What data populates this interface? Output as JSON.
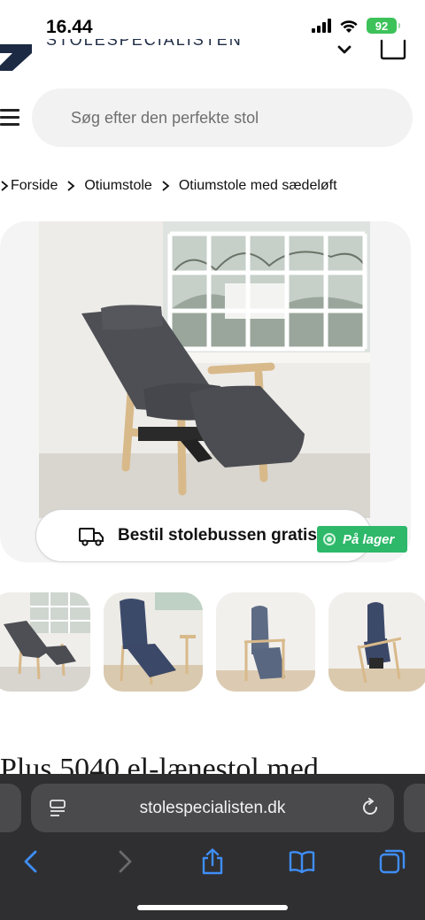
{
  "status_bar": {
    "time": "16.44",
    "battery": "92"
  },
  "header": {
    "logo_text": "STOLESPECIALISTEN",
    "logo_icon": "brand-logo-icon",
    "account_chevron_icon": "chevron-down-icon",
    "cart_icon": "bag-icon"
  },
  "search": {
    "placeholder": "Søg efter den perfekte stol",
    "menu_icon": "hamburger-menu-icon"
  },
  "breadcrumb": {
    "items": [
      "Forside",
      "Otiumstole",
      "Otiumstole med sædeløft"
    ],
    "separator_icon": "chevron-right-icon"
  },
  "product": {
    "delivery_text": "Bestil stolebussen gratis",
    "delivery_icon": "truck-icon",
    "stock_badge": "På lager",
    "title": "Plus 5040 el-lænestol med",
    "thumbnails": [
      "grey-recliner-reclined",
      "blue-recliner-table",
      "blue-recliner-front",
      "recliner-seat-lift"
    ]
  },
  "browser": {
    "url": "stolespecialisten.dk",
    "icons": [
      "page-settings-icon",
      "reload-icon",
      "back-icon",
      "forward-icon",
      "share-icon",
      "bookmarks-icon",
      "tabs-icon"
    ]
  },
  "colors": {
    "stock_green": "#2db86a",
    "search_bg": "#f2f2f2",
    "toolbar_bg": "#2f2f31",
    "ios_blue": "#3f8ef7"
  }
}
